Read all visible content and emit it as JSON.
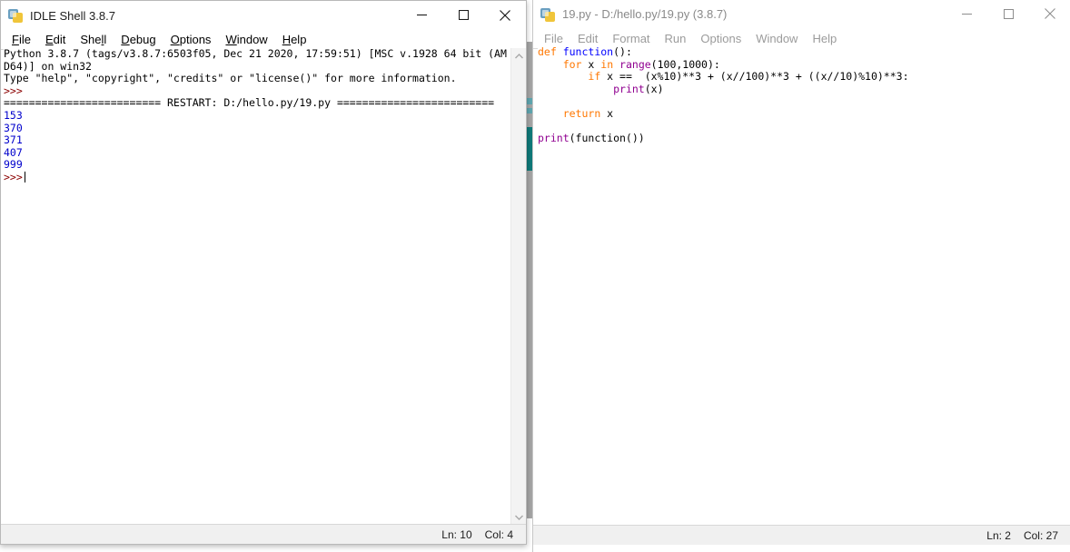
{
  "shell_window": {
    "title": "IDLE Shell 3.8.7",
    "icon": "python-logo-icon",
    "caption": {
      "minimize": "minimize-icon",
      "maximize": "maximize-icon",
      "close": "close-icon"
    },
    "menu": [
      {
        "pre": "",
        "mnemonic": "F",
        "post": "ile"
      },
      {
        "pre": "",
        "mnemonic": "E",
        "post": "dit"
      },
      {
        "pre": "She",
        "mnemonic": "l",
        "post": "l"
      },
      {
        "pre": "",
        "mnemonic": "D",
        "post": "ebug"
      },
      {
        "pre": "",
        "mnemonic": "O",
        "post": "ptions"
      },
      {
        "pre": "",
        "mnemonic": "W",
        "post": "indow"
      },
      {
        "pre": "",
        "mnemonic": "H",
        "post": "elp"
      }
    ],
    "banner": [
      "Python 3.8.7 (tags/v3.8.7:6503f05, Dec 21 2020, 17:59:51) [MSC v.1928 64 bit (AM",
      "D64)] on win32",
      "Type \"help\", \"copyright\", \"credits\" or \"license()\" for more information."
    ],
    "prompt": ">>>",
    "restart_line": "========================= RESTART: D:/hello.py/19.py =========================",
    "output": [
      "153",
      "370",
      "371",
      "407",
      "999"
    ],
    "last_prompt": ">>>",
    "status": {
      "line_label": "Ln: 10",
      "col_label": "Col: 4"
    }
  },
  "editor_window": {
    "title": "19.py - D:/hello.py/19.py (3.8.7)",
    "icon": "python-logo-icon",
    "caption": {
      "minimize": "minimize-icon",
      "maximize": "maximize-icon",
      "close": "close-icon"
    },
    "menu": [
      "File",
      "Edit",
      "Format",
      "Run",
      "Options",
      "Window",
      "Help"
    ],
    "code": [
      [
        {
          "t": "def ",
          "c": "kw"
        },
        {
          "t": "function",
          "c": "name"
        },
        {
          "t": "():",
          "c": "plain"
        }
      ],
      [
        {
          "t": "    ",
          "c": "plain"
        },
        {
          "t": "for ",
          "c": "kw"
        },
        {
          "t": "x ",
          "c": "plain"
        },
        {
          "t": "in ",
          "c": "kw"
        },
        {
          "t": "range",
          "c": "builtin"
        },
        {
          "t": "(100,1000):",
          "c": "plain"
        }
      ],
      [
        {
          "t": "        ",
          "c": "plain"
        },
        {
          "t": "if ",
          "c": "kw"
        },
        {
          "t": "x ==  (x%10)**3 + (x//100)**3 + ((x//10)%10)**3:",
          "c": "plain"
        }
      ],
      [
        {
          "t": "            ",
          "c": "plain"
        },
        {
          "t": "print",
          "c": "builtin"
        },
        {
          "t": "(x)",
          "c": "plain"
        }
      ],
      [
        {
          "t": "",
          "c": "plain"
        }
      ],
      [
        {
          "t": "    ",
          "c": "plain"
        },
        {
          "t": "return ",
          "c": "kw"
        },
        {
          "t": "x",
          "c": "plain"
        }
      ],
      [
        {
          "t": "",
          "c": "plain"
        }
      ],
      [
        {
          "t": "print",
          "c": "builtin"
        },
        {
          "t": "(function())",
          "c": "plain"
        }
      ]
    ],
    "status": {
      "line_label": "Ln: 2",
      "col_label": "Col: 27"
    }
  },
  "colors": {
    "keyword": "#ff7700",
    "definition": "#0000ff",
    "builtin": "#900090",
    "output": "#0000cc",
    "prompt": "#8b0000",
    "window_bg": "#ffffff",
    "statusbar_bg": "#f0f0f0"
  }
}
